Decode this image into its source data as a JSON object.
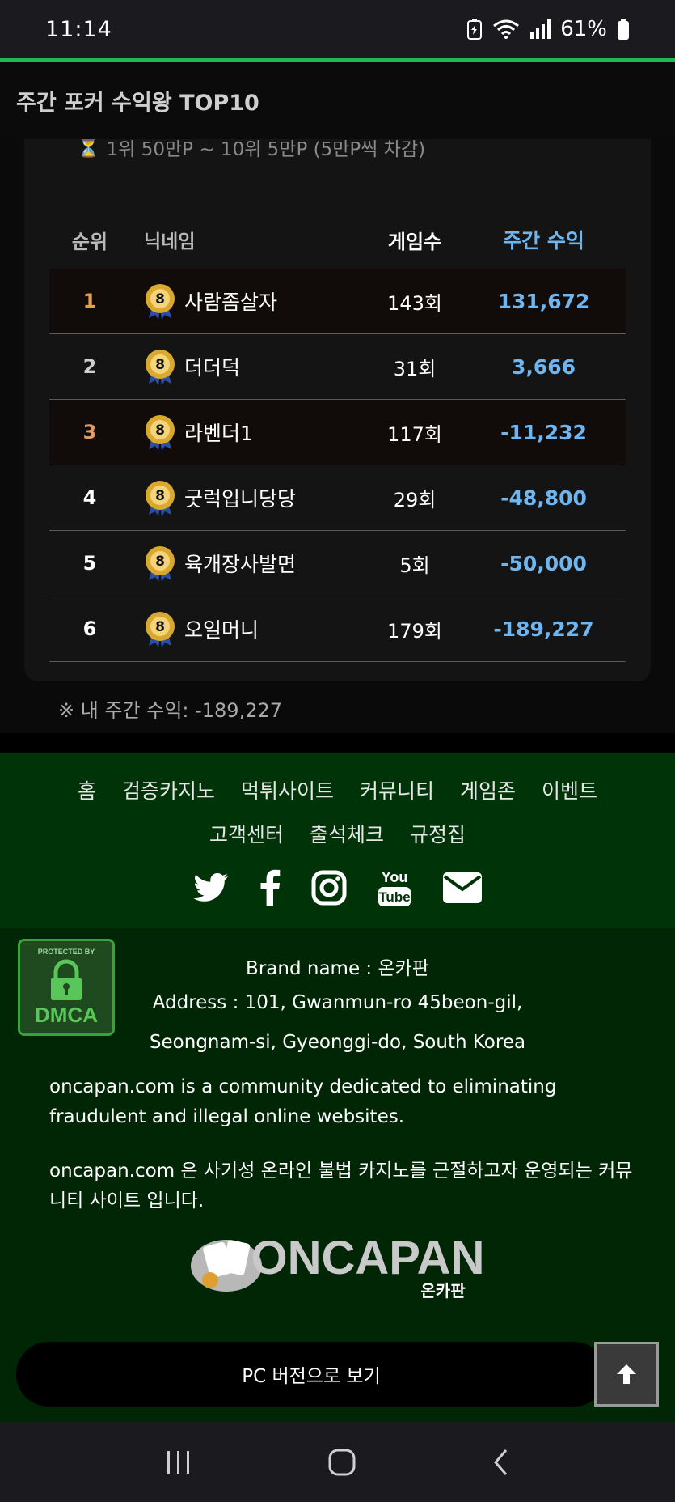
{
  "status": {
    "time": "11:14",
    "battery": "61%"
  },
  "header": {
    "title": "주간 포커 수익왕 TOP10"
  },
  "prize": {
    "icon": "trophy-icon",
    "text": "1위 50만P ~ 10위 5만P (5만P씩 차감)"
  },
  "table": {
    "headers": {
      "rank": "순위",
      "nickname": "닉네임",
      "games": "게임수",
      "profit": "주간 수익"
    },
    "rows": [
      {
        "rank": "1",
        "nickname": "사람좀살자",
        "games": "143회",
        "profit": "131,672"
      },
      {
        "rank": "2",
        "nickname": "더더덕",
        "games": "31회",
        "profit": "3,666"
      },
      {
        "rank": "3",
        "nickname": "라벤더1",
        "games": "117회",
        "profit": "-11,232"
      },
      {
        "rank": "4",
        "nickname": "굿럭입니당당",
        "games": "29회",
        "profit": "-48,800"
      },
      {
        "rank": "5",
        "nickname": "육개장사발면",
        "games": "5회",
        "profit": "-50,000"
      },
      {
        "rank": "6",
        "nickname": "오일머니",
        "games": "179회",
        "profit": "-189,227"
      }
    ],
    "level_badge": "8"
  },
  "my_profit": "※ 내 주간 수익: -189,227",
  "footer": {
    "nav": [
      "홈",
      "검증카지노",
      "먹튀사이트",
      "커뮤니티",
      "게임존",
      "이벤트",
      "고객센터",
      "출석체크",
      "규정집"
    ],
    "social": [
      "twitter-icon",
      "facebook-icon",
      "instagram-icon",
      "youtube-icon",
      "mail-icon"
    ],
    "youtube_text_1": "You",
    "youtube_text_2": "Tube",
    "dmca": {
      "top": "PROTECTED BY",
      "bottom": "DMCA"
    },
    "brand": "Brand name : 온카판",
    "address1": "Address : 101, Gwanmun-ro 45beon-gil,",
    "address2": "Seongnam-si, Gyeonggi-do, South Korea",
    "desc_en": "oncapan.com is a community dedicated to eliminating fraudulent and illegal online websites.",
    "desc_ko": "oncapan.com 은 사기성 온라인 불법 카지노를 근절하고자 운영되는 커뮤니티 사이트 입니다.",
    "logo_text": "ONCAPAN",
    "logo_sub": "온카판",
    "pc_version": "PC 버전으로 보기"
  },
  "colors": {
    "accent_green": "#1db954",
    "footer_green": "#003308",
    "profit_blue": "#6fb6f0",
    "rank_gold": "#e3a04b"
  }
}
